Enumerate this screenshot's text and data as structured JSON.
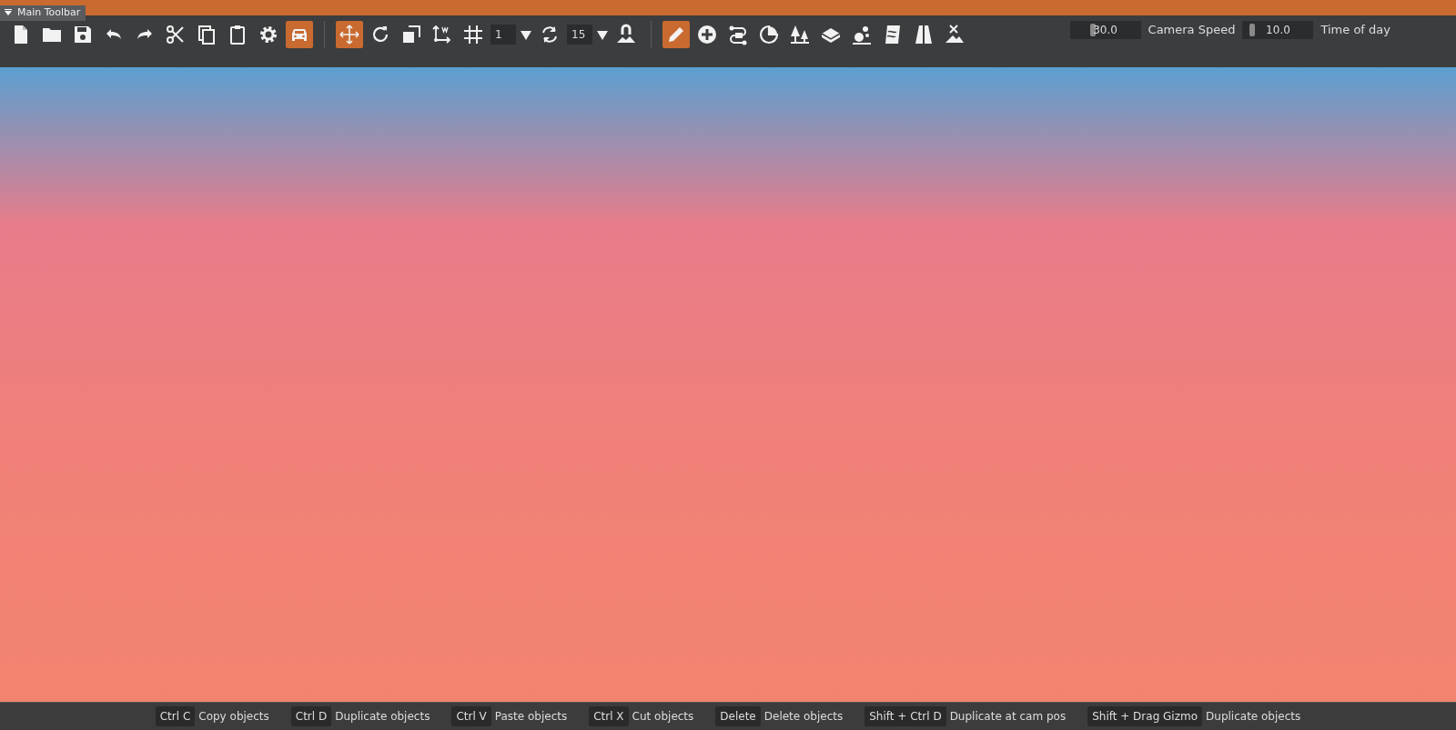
{
  "panel": {
    "title": "Main Toolbar"
  },
  "toolbar": [
    {
      "kind": "icon",
      "active": false
    },
    {
      "kind": "icon",
      "active": false
    },
    {
      "kind": "icon",
      "active": false
    },
    {
      "kind": "icon",
      "active": false
    },
    {
      "kind": "icon",
      "active": false
    },
    {
      "kind": "icon",
      "active": false
    },
    {
      "kind": "icon",
      "active": false
    },
    {
      "kind": "icon",
      "active": false
    },
    {
      "kind": "icon",
      "active": false
    },
    {
      "kind": "icon",
      "active": true
    },
    {
      "kind": "separator"
    },
    {
      "kind": "icon",
      "active": true
    },
    {
      "kind": "icon",
      "active": false
    },
    {
      "kind": "icon",
      "active": false
    },
    {
      "kind": "icon",
      "active": false
    },
    {
      "kind": "icon",
      "active": false
    },
    {
      "kind": "field",
      "value": "1"
    },
    {
      "kind": "dropdown"
    },
    {
      "kind": "icon",
      "active": false
    },
    {
      "kind": "field",
      "value": "15"
    },
    {
      "kind": "dropdown"
    },
    {
      "kind": "icon",
      "active": false
    },
    {
      "kind": "separator"
    },
    {
      "kind": "icon",
      "active": true
    },
    {
      "kind": "icon",
      "active": false
    },
    {
      "kind": "icon",
      "active": false
    },
    {
      "kind": "icon",
      "active": false
    },
    {
      "kind": "icon",
      "active": false
    },
    {
      "kind": "icon",
      "active": false
    },
    {
      "kind": "icon",
      "active": false
    },
    {
      "kind": "icon",
      "active": false
    },
    {
      "kind": "icon",
      "active": false
    },
    {
      "kind": "icon",
      "active": false
    }
  ],
  "sliders": [
    {
      "value": "30.0",
      "level": 0.3,
      "label": "Camera Speed"
    },
    {
      "value": "10.0",
      "level": 0.1,
      "label": "Time of day"
    }
  ],
  "shortcuts": [
    {
      "key": "Ctrl C",
      "action": "Copy objects"
    },
    {
      "key": "Ctrl D",
      "action": "Duplicate objects"
    },
    {
      "key": "Ctrl V",
      "action": "Paste objects"
    },
    {
      "key": "Ctrl X",
      "action": "Cut objects"
    },
    {
      "key": "Delete",
      "action": "Delete objects"
    },
    {
      "key": "Shift + Ctrl D",
      "action": "Duplicate at cam pos"
    },
    {
      "key": "Shift + Drag Gizmo",
      "action": "Duplicate objects"
    }
  ]
}
